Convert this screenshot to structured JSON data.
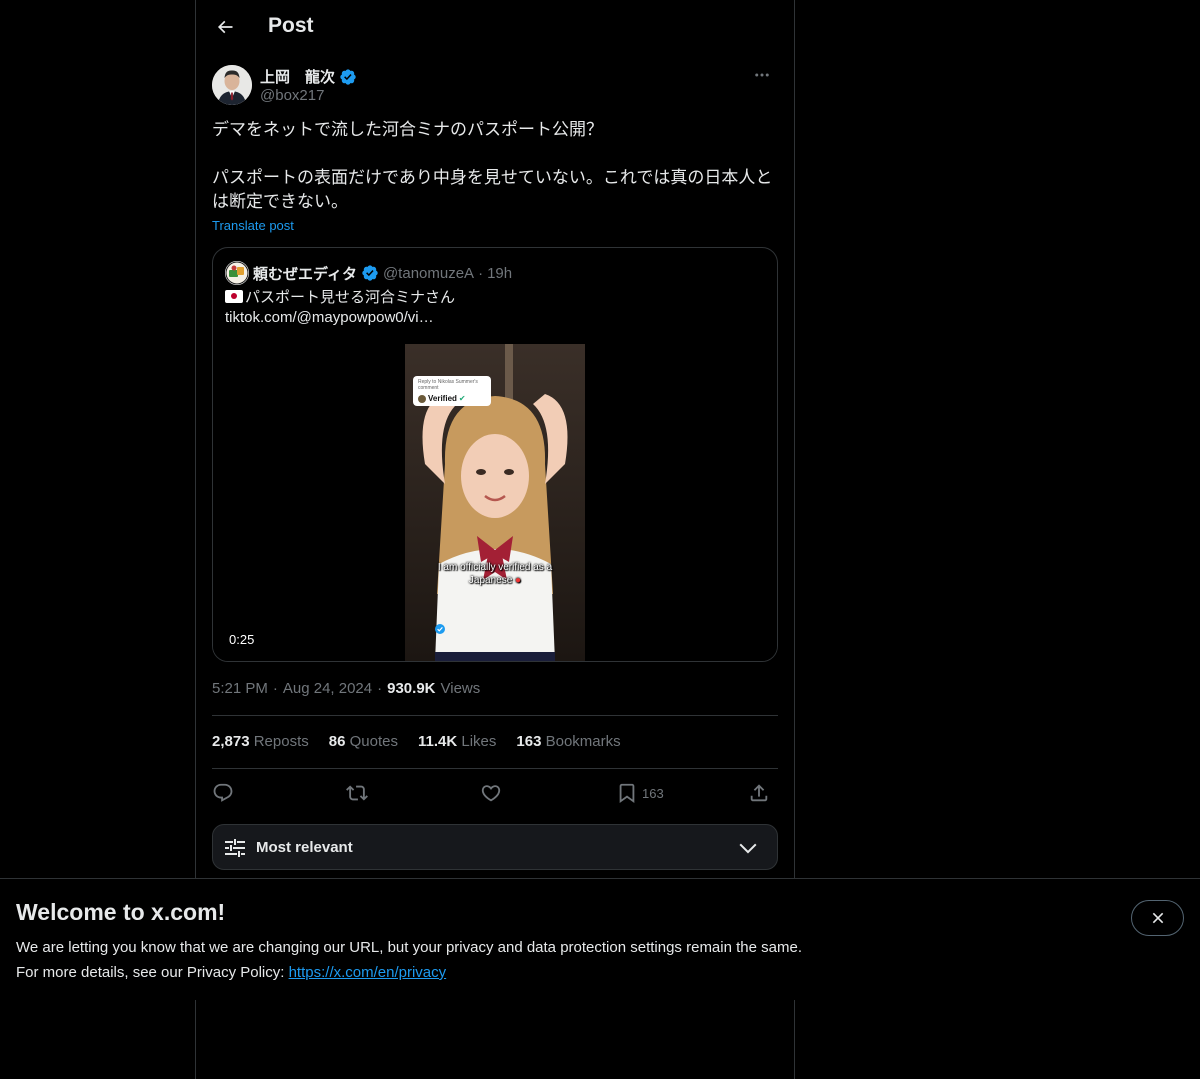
{
  "header": {
    "back_icon": "arrow-left-icon",
    "title": "Post"
  },
  "post": {
    "author_name": "上岡　龍次",
    "author_handle": "@box217",
    "verified": true,
    "text": "デマをネットで流した河合ミナのパスポート公開？\n\nパスポートの表面だけであり中身を見せていない。これでは真の日本人とは断定できない。",
    "translate_label": "Translate post",
    "time": "5:21 PM",
    "date": "Aug 24, 2024",
    "views_count": "930.9K",
    "views_label": "Views"
  },
  "quote": {
    "author_name": "頼むぜエディタ",
    "author_handle": "@tanomuzeA",
    "separator": "·",
    "time": "19h",
    "text": "パスポート見せる河合ミナさん",
    "link": "tiktok.com/@maypowpow0/vi…",
    "video_duration": "0:25",
    "video_comment_line1": "Reply to Nikolas Summer's",
    "video_comment_line2": "comment",
    "video_comment_main": "Verified",
    "video_caption_line1": "I am officially verified as a",
    "video_caption_line2": "Japanese"
  },
  "stats": {
    "reposts_count": "2,873",
    "reposts_label": "Reposts",
    "quotes_count": "86",
    "quotes_label": "Quotes",
    "likes_count": "11.4K",
    "likes_label": "Likes",
    "bookmarks_count": "163",
    "bookmarks_label": "Bookmarks"
  },
  "actions": {
    "reply_icon": "reply-icon",
    "repost_icon": "repost-icon",
    "like_icon": "heart-icon",
    "bookmark_icon": "bookmark-icon",
    "bookmark_count": "163",
    "share_icon": "share-icon"
  },
  "sort": {
    "label": "Most relevant"
  },
  "banner": {
    "title": "Welcome to x.com!",
    "line1": "We are letting you know that we are changing our URL, but your privacy and data protection settings remain the same.",
    "line2_prefix": "For more details, see our Privacy Policy: ",
    "link": "https://x.com/en/privacy"
  },
  "colors": {
    "background": "#000000",
    "text": "#e7e9ea",
    "muted": "#71767b",
    "accent": "#1d9bf0",
    "border": "#2f3336"
  }
}
